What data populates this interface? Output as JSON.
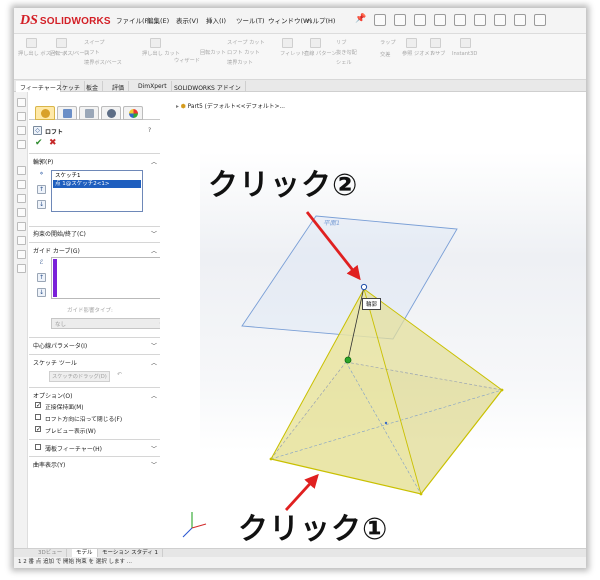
{
  "app": {
    "logo_mark": "DS",
    "logo_text": "SOLIDWORKS"
  },
  "menu": [
    "ファイル(F)",
    "編集(E)",
    "表示(V)",
    "挿入(I)",
    "ツール(T)",
    "ウィンドウ(W)",
    "ヘルプ(H)"
  ],
  "ribbon": [
    "押し出し ボス/ベース",
    "回転 ボス/ベース",
    "スイープ",
    "ロフト",
    "境界ボス/ベース",
    "押し出し カット",
    "ウィザード",
    "回転カット",
    "スイープ カット",
    "ロフト カット",
    "境界カット",
    "フィレット",
    "直線 パターン",
    "リブ",
    "抜き勾配",
    "シェル",
    "ラップ",
    "交差",
    "参照 ジオメトリ",
    "カーブ",
    "Instant3D"
  ],
  "tabs": [
    "フィーチャー",
    "スケッチ",
    "板金",
    "評価",
    "DimXpert",
    "SOLIDWORKS アドイン"
  ],
  "property_manager": {
    "title": "ロフト",
    "help": "?",
    "ok": "✔",
    "cancel": "✖",
    "profile_section": "輪郭(P)",
    "profile_items": [
      "スケッチ1",
      "点 1@スケッチ2<1>"
    ],
    "start_end": "拘束の開始/終了(C)",
    "guide_section": "ガイド カーブ(G)",
    "guide_type_label": "ガイド影響タイプ:",
    "guide_type_value": "なし",
    "centerline": "中心線パラメータ(I)",
    "sketch_tool": "スケッチ ツール",
    "sketch_tool_btn": "スケッチのドラッグ(D)",
    "options": "オプション(O)",
    "option_items": [
      {
        "label": "正接保持面(M)",
        "checked": true
      },
      {
        "label": "ロフト方向に沿って閉じる(F)",
        "checked": false
      },
      {
        "label": "プレビュー表示(W)",
        "checked": true
      }
    ],
    "thin_feature": "薄板フィーチャー(H)",
    "curvature": "曲率表示(Y)"
  },
  "graphics": {
    "tree_item": "Part5 (デフォルト<<デフォルト>...",
    "plane_label": "平面1",
    "profile_tooltip": "輪郭",
    "click1": "クリック①",
    "click2": "クリック②"
  },
  "bottom_tabs": [
    "3Dビュー",
    "モデル",
    "モーション スタディ 1"
  ],
  "status": "1 2 番 点 追加 で 開始 拘束 を 選択 します ...",
  "colors": {
    "brand": "#d31f26",
    "plane": "#7a9fd6",
    "pyramid_fill": "#e7e29a",
    "pyramid_edge": "#c9c000",
    "arrow": "#e02020"
  }
}
